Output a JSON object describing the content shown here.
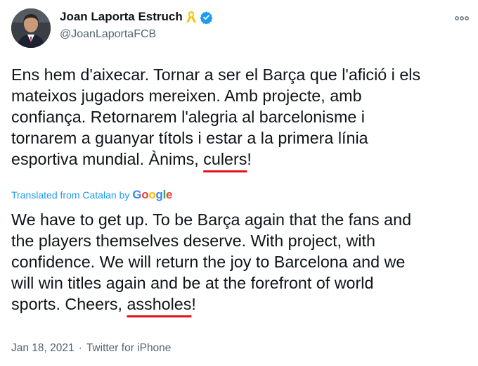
{
  "profile": {
    "name": "Joan Laporta Estruch",
    "handle": "@JoanLaportaFCB",
    "ribbon_emoji_color": "#f5c518",
    "verified_color": "#1d9bf0"
  },
  "tweet": {
    "lines": [
      "Ens hem d'aixecar. Tornar a ser el Barça que l'afició i els",
      "mateixos jugadors mereixen. Amb projecte, amb",
      "confiança. Retornarem l'alegria al barcelonisme i",
      "tornarem a guanyar títols i estar a la primera línia"
    ],
    "last_line_prefix": "esportiva mundial. Ànims, ",
    "highlight_word": "culers",
    "last_line_suffix": "!"
  },
  "translation": {
    "label": "Translated from Catalan by",
    "provider_letters": [
      "G",
      "o",
      "o",
      "g",
      "l",
      "e"
    ],
    "lines": [
      "We have to get up. To be Barça again that the fans and",
      "the players themselves deserve. With project, with",
      "confidence. We will return the joy to Barcelona and we",
      "will win titles again and be at the forefront of world"
    ],
    "last_line_prefix": "sports. Cheers, ",
    "highlight_word": "assholes",
    "last_line_suffix": "!"
  },
  "meta": {
    "date": "Jan 18, 2021",
    "separator": "·",
    "source": "Twitter for iPhone"
  },
  "colors": {
    "underline": "#e0141e",
    "link": "#1d9bf0",
    "muted": "#536471"
  },
  "icons": {
    "more": "more-horizontal-icon",
    "verified": "verified-badge-icon",
    "ribbon": "yellow-ribbon-icon"
  }
}
